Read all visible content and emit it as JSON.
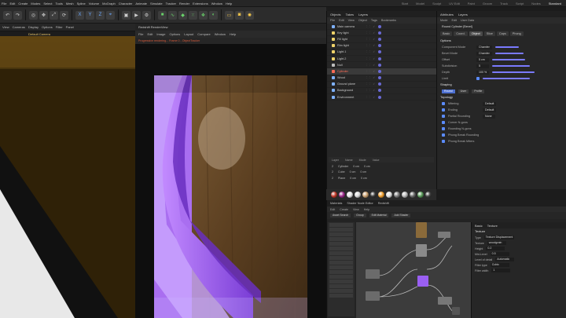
{
  "menubar": {
    "items": [
      "File",
      "Edit",
      "Create",
      "Modes",
      "Select",
      "Tools",
      "Mesh",
      "Spline",
      "Volume",
      "MoGraph",
      "Character",
      "Animate",
      "Simulate",
      "Tracker",
      "Render",
      "Extensions",
      "Window",
      "Help"
    ],
    "layouts": [
      "Start",
      "Model",
      "Sculpt",
      "UV Edit",
      "Paint",
      "Groom",
      "Track",
      "Script",
      "Nodes",
      "Standard"
    ],
    "active_layout": "Standard"
  },
  "toolbar": {
    "icons": [
      "undo-icon",
      "redo-icon",
      "separator",
      "live-select-icon",
      "move-icon",
      "scale-icon",
      "rotate-icon",
      "separator",
      "x-axis-icon",
      "y-axis-icon",
      "z-axis-icon",
      "coord-icon",
      "separator",
      "render-view-icon",
      "render-icon",
      "render-settings-icon",
      "separator",
      "cube-icon",
      "spline-icon",
      "subdivision-icon",
      "array-icon",
      "cloner-icon",
      "deformer-icon",
      "separator",
      "floor-icon",
      "camera-icon",
      "light-icon"
    ]
  },
  "viewport": {
    "menu": [
      "View",
      "Cameras",
      "Display",
      "Options",
      "Filter",
      "Panel"
    ],
    "camera_label": "Default Camera"
  },
  "render_window": {
    "title": "Redshift RenderView",
    "menu": [
      "File",
      "Edit",
      "Image",
      "Options",
      "Layout",
      "Compare",
      "Window",
      "Help"
    ],
    "info": "Progressive rendering... Frame 0 - ObjectTracker",
    "overlay": "#4F1A1A"
  },
  "object_manager": {
    "tabs": [
      "Objects",
      "Takes",
      "Layers"
    ],
    "menu": [
      "File",
      "Edit",
      "View",
      "Object",
      "Tags",
      "Bookmarks"
    ],
    "rows": [
      {
        "name": "Main camera",
        "color": "#7fb2ff"
      },
      {
        "name": "Key light",
        "color": "#f0d36a"
      },
      {
        "name": "Fill light",
        "color": "#f0d36a"
      },
      {
        "name": "Rim light",
        "color": "#f0d36a"
      },
      {
        "name": "Light.1",
        "color": "#f0d36a"
      },
      {
        "name": "Light.2",
        "color": "#f0d36a"
      },
      {
        "name": "Null",
        "color": "#bdbdbd"
      },
      {
        "name": "Cylinder",
        "color": "#ff6b55",
        "selected": true
      },
      {
        "name": "Wood",
        "color": "#7fb2ff"
      },
      {
        "name": "Ground plane",
        "color": "#7fb2ff"
      },
      {
        "name": "Background",
        "color": "#7fb2ff"
      },
      {
        "name": "Environment",
        "color": "#7fb2ff"
      }
    ],
    "lower_headers": [
      "Layer",
      "Name",
      "Mode",
      "Value"
    ],
    "lower_rows": [
      [
        "2",
        "Cylinder",
        "0 cm",
        "0 cm"
      ],
      [
        "2",
        "Cube",
        "0 cm",
        "0 cm"
      ],
      [
        "2",
        "Plane",
        "0 cm",
        "0 cm"
      ]
    ]
  },
  "attributes": {
    "tabs": [
      "Attributes",
      "Layers"
    ],
    "mode_menu": [
      "Mode",
      "Edit",
      "User Data"
    ],
    "object_name": "Round Cylinder [Bevel]",
    "page_tabs": [
      "Basic",
      "Coord.",
      "Object",
      "Slice",
      "Caps",
      "Phong"
    ],
    "active_tab": "Object",
    "section_options": "Options",
    "rows": [
      {
        "label": "Component Mode",
        "value": "Chamfer"
      },
      {
        "label": "Bevel Mode",
        "value": "Chamfer"
      },
      {
        "label": "Offset",
        "value": "5 cm"
      },
      {
        "label": "Subdivision",
        "value": "5"
      },
      {
        "label": "Depth",
        "value": "100 %"
      },
      {
        "label": "Limit",
        "value": ""
      }
    ],
    "section_shaping": "Shaping",
    "shape_options": [
      "Round",
      "User",
      "Profile"
    ],
    "section_topology": "Topology",
    "topology_rows": [
      {
        "label": "Mitering",
        "value": "Default"
      },
      {
        "label": "Ending",
        "value": "Default"
      },
      {
        "label": "Partial Rounding",
        "value": "None"
      },
      {
        "label": "Corner N-gons",
        "value": ""
      },
      {
        "label": "Rounding N-gons",
        "value": ""
      },
      {
        "label": "Phong Break Rounding",
        "value": ""
      },
      {
        "label": "Phong Break Miters",
        "value": ""
      }
    ]
  },
  "material_bar": {
    "swatches": [
      "#c23a2a",
      "#9a2a8a",
      "#e8e8e8",
      "#d8d8d8",
      "#c9a070",
      "#3a3a3a",
      "#f0a030",
      "#e0e0e0",
      "#7d7d7d",
      "#b8b8b8",
      "#6a6a6a",
      "#5a9a5a",
      "#444"
    ]
  },
  "node_editor": {
    "tabs": [
      "Materials",
      "Shader Node Editor",
      "Redshift"
    ],
    "menu": [
      "Edit",
      "Create",
      "View",
      "Help"
    ],
    "chips": [
      "Asset Search",
      "Group",
      "Edit Material",
      "Add Shader"
    ],
    "props_tabs": [
      "Basic",
      "Texture"
    ],
    "props_header": "Texture",
    "props_rows": [
      {
        "label": "Type",
        "value": "Texture Displacement"
      },
      {
        "label": "Texture",
        "value": "woodgrain"
      },
      {
        "label": "Height",
        "value": "0.2"
      },
      {
        "label": "Mid-Level",
        "value": "0.5"
      },
      {
        "label": "Level of detail",
        "value": "Automatic"
      },
      {
        "label": "Filter type",
        "value": "Cubic"
      },
      {
        "label": "Filter width",
        "value": "1"
      }
    ]
  }
}
